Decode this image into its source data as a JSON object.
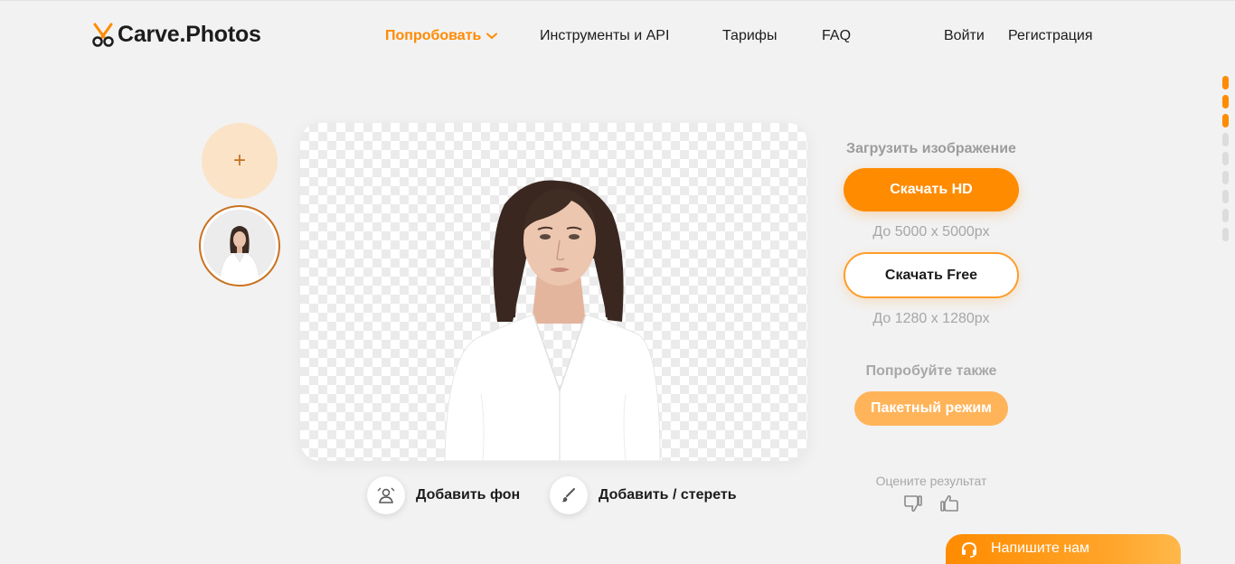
{
  "header": {
    "logo_text": "Carve.Photos",
    "nav": {
      "try": "Попробовать",
      "tools": "Инструменты и API",
      "prices": "Тарифы",
      "faq": "FAQ",
      "login": "Войти",
      "register": "Регистрация"
    }
  },
  "left_panel": {
    "add_symbol": "+"
  },
  "tools": {
    "add_background": "Добавить фон",
    "add_erase": "Добавить / стереть"
  },
  "right_panel": {
    "upload_label": "Загрузить изображение",
    "hd_button": "Скачать HD",
    "hd_size": "До 5000 x 5000px",
    "free_button": "Скачать Free",
    "free_size": "До 1280 x 1280px",
    "try_also": "Попробуйте также",
    "batch_button": "Пакетный режим",
    "rate_label": "Оцените результат"
  },
  "chat": {
    "label": "Напишите нам"
  },
  "colors": {
    "accent": "#ff8b00",
    "accent_light": "#ffb45a",
    "background": "#f2f2f2",
    "add_circle": "#fbe3c8"
  },
  "icons": [
    "scissors-logo-icon",
    "chevron-down-icon",
    "plus-icon",
    "background-icon",
    "brush-icon",
    "thumbs-down-icon",
    "thumbs-up-icon",
    "headset-icon"
  ],
  "scroll_indicator": {
    "total": 9,
    "active": 3
  }
}
